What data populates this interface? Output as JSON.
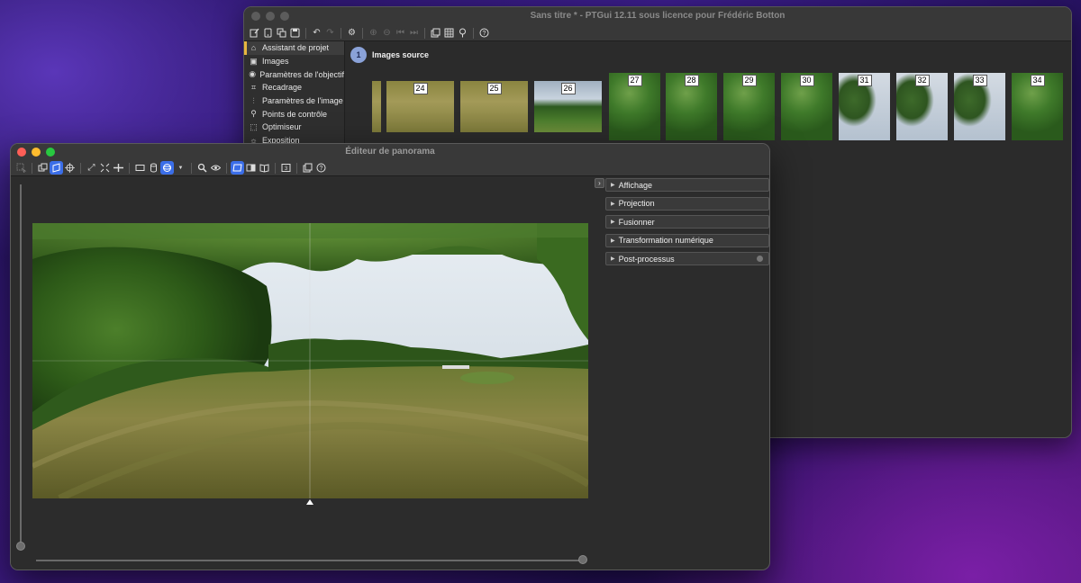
{
  "main_window": {
    "title": "Sans titre * - PTGui 12.11 sous licence pour Frédéric Botton",
    "toolbar_icons": [
      "new-project-icon",
      "open-icon",
      "copy-icon",
      "save-icon",
      "undo-icon",
      "redo-icon",
      "settings-icon",
      "zoom-in-icon",
      "zoom-out-icon",
      "first-icon",
      "last-icon",
      "panorama-editor-icon",
      "table-icon",
      "pin-icon",
      "help-icon"
    ],
    "sidebar": {
      "items": [
        {
          "label": "Assistant de projet",
          "icon": "home-icon",
          "active": true
        },
        {
          "label": "Images",
          "icon": "images-icon",
          "active": false
        },
        {
          "label": "Paramètres de l'objectif",
          "icon": "camera-icon",
          "active": false
        },
        {
          "label": "Recadrage",
          "icon": "crop-icon",
          "active": false
        },
        {
          "label": "Paramètres de l'image",
          "icon": "sliders-icon",
          "active": false
        },
        {
          "label": "Points de contrôle",
          "icon": "control-points-icon",
          "active": false
        },
        {
          "label": "Optimiseur",
          "icon": "optimizer-icon",
          "active": false
        },
        {
          "label": "Exposition",
          "icon": "sun-icon",
          "active": false
        }
      ]
    },
    "step_number": "1",
    "section_title": "Images source",
    "thumbnails": [
      {
        "num": "24",
        "kind": "grass"
      },
      {
        "num": "25",
        "kind": "grass"
      },
      {
        "num": "26",
        "kind": "field"
      },
      {
        "num": "27",
        "kind": "tree"
      },
      {
        "num": "28",
        "kind": "tree"
      },
      {
        "num": "29",
        "kind": "tree"
      },
      {
        "num": "30",
        "kind": "tree"
      },
      {
        "num": "31",
        "kind": "sky"
      },
      {
        "num": "32",
        "kind": "sky"
      },
      {
        "num": "33",
        "kind": "sky"
      },
      {
        "num": "34",
        "kind": "tree"
      }
    ]
  },
  "editor_window": {
    "title": "Éditeur de panorama",
    "toolbar_icons": [
      "select-icon",
      "edit-mode-icon",
      "move-icon",
      "center-icon",
      "fit-icon",
      "shrink-icon",
      "level-icon",
      "rectilinear-icon",
      "cylindrical-icon",
      "spherical-icon",
      "dropdown-icon",
      "zoom-icon",
      "eye-icon",
      "frame-icon",
      "split-icon",
      "book-icon",
      "numeric-icon",
      "layers-icon",
      "help-icon"
    ],
    "panels": [
      {
        "label": "Affichage",
        "has_dot": false
      },
      {
        "label": "Projection",
        "has_dot": false
      },
      {
        "label": "Fusionner",
        "has_dot": false
      },
      {
        "label": "Transformation numérique",
        "has_dot": false
      },
      {
        "label": "Post-processus",
        "has_dot": true
      }
    ]
  }
}
